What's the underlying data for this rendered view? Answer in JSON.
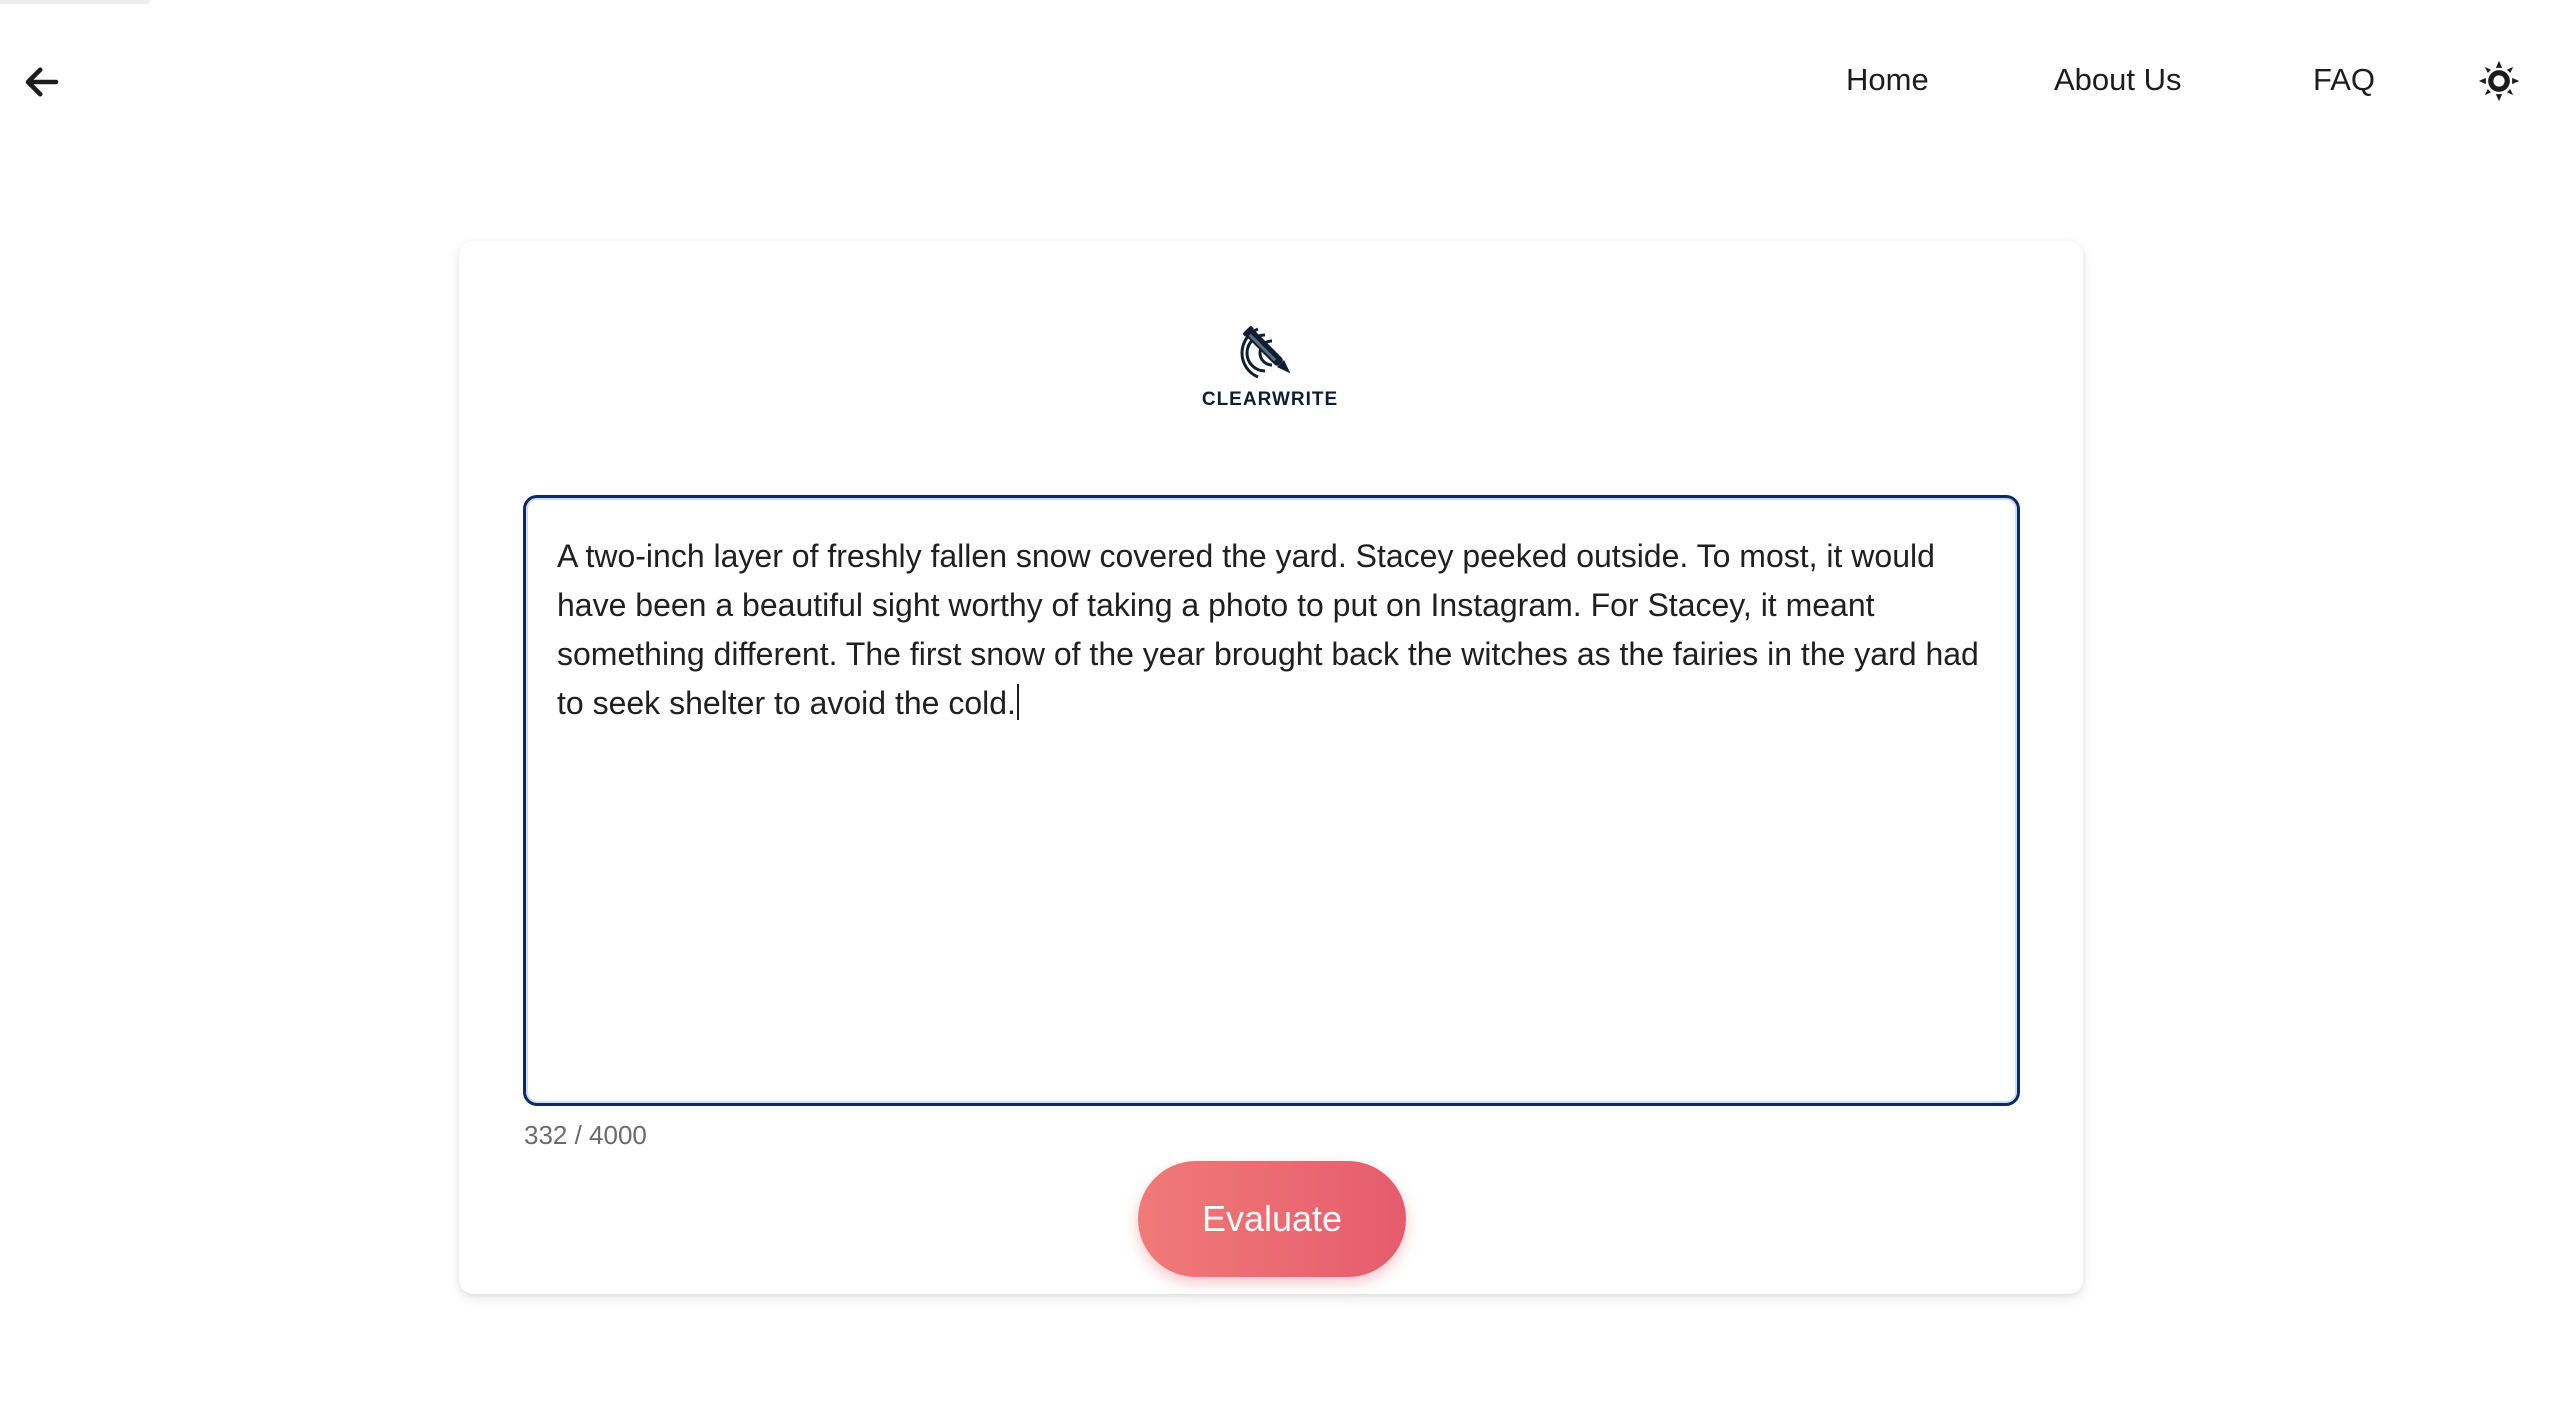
{
  "header": {
    "back_icon": "arrow-left-icon",
    "nav": {
      "home": "Home",
      "about": "About Us",
      "faq": "FAQ"
    },
    "theme_icon": "sun-icon"
  },
  "brand": {
    "name": "CLEARWRITE",
    "icon": "pen-logo-icon",
    "color": "#0f1e33"
  },
  "editor": {
    "value": "A two-inch layer of freshly fallen snow covered the yard. Stacey peeked outside. To most, it would have been a beautiful sight worthy of taking a photo to put on Instagram. For Stacey, it meant something different. The first snow of the year brought back the witches as the fairies in the yard had to seek shelter to avoid the cold.",
    "border_color": "#0e2a5e"
  },
  "counter": {
    "text": "332 / 4000"
  },
  "actions": {
    "evaluate_label": "Evaluate",
    "evaluate_color_start": "#f07a78",
    "evaluate_color_end": "#e65c6e"
  }
}
